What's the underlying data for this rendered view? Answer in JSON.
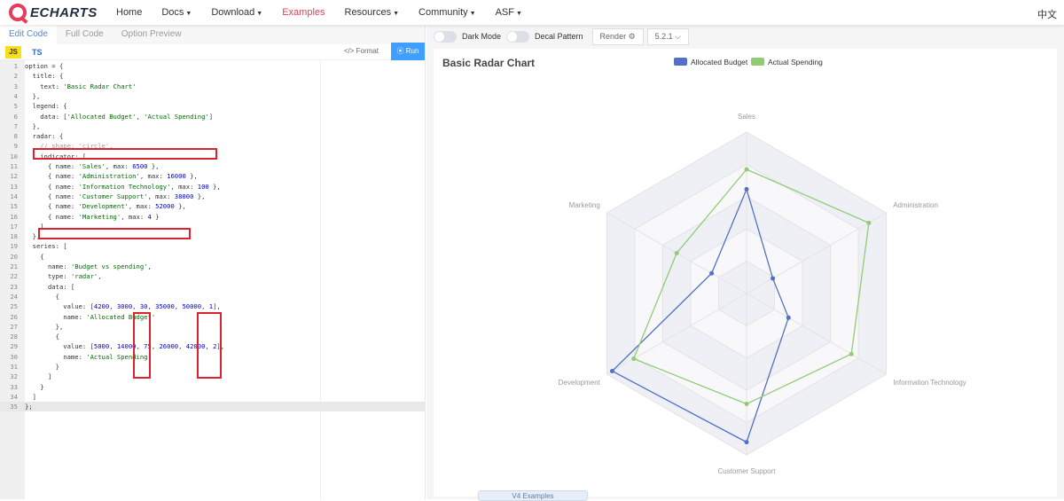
{
  "nav": {
    "logo": "ECHARTS",
    "items": [
      "Home",
      "Docs",
      "Download",
      "Examples",
      "Resources",
      "Community",
      "ASF"
    ],
    "dropdown": [
      false,
      true,
      true,
      false,
      true,
      true,
      true
    ],
    "active": "Examples",
    "lang": "中文"
  },
  "editor": {
    "tabs": [
      "Edit Code",
      "Full Code",
      "Option Preview"
    ],
    "lang_js": "JS",
    "lang_ts": "TS",
    "format": "</> Format",
    "run": "⦿ Run",
    "lines": [
      "option = {",
      "  title: {",
      "    text: 'Basic Radar Chart'",
      "  },",
      "  legend: {",
      "    data: ['Allocated Budget', 'Actual Spending']",
      "  },",
      "  radar: {",
      "    // shape: 'circle',",
      "    indicator: [",
      "      { name: 'Sales', max: 6500 },",
      "      { name: 'Administration', max: 16000 },",
      "      { name: 'Information Technology', max: 100 },",
      "      { name: 'Customer Support', max: 38000 },",
      "      { name: 'Development', max: 52000 },",
      "      { name: 'Marketing', max: 4 }",
      "    ]",
      "  },",
      "  series: [",
      "    {",
      "      name: 'Budget vs spending',",
      "      type: 'radar',",
      "      data: [",
      "        {",
      "          value: [4200, 3000, 30, 35000, 50000, 1],",
      "          name: 'Allocated Budget'",
      "        },",
      "        {",
      "          value: [5000, 14000, 75, 26000, 42000, 2],",
      "          name: 'Actual Spending'",
      "        }",
      "      ]",
      "    }",
      "  ]",
      "};"
    ]
  },
  "toolbar": {
    "dark_mode": "Dark Mode",
    "decal": "Decal Pattern",
    "render": "Render ⚙",
    "version": "5.2.1 ⌵"
  },
  "footer": "V4 Examples",
  "colors": {
    "budget": "#5470c6",
    "spending": "#91cc75"
  },
  "chart_data": {
    "type": "radar",
    "title": "Basic Radar Chart",
    "indicators": [
      {
        "name": "Sales",
        "max": 6500
      },
      {
        "name": "Administration",
        "max": 16000
      },
      {
        "name": "Information Technology",
        "max": 100
      },
      {
        "name": "Customer Support",
        "max": 38000
      },
      {
        "name": "Development",
        "max": 52000
      },
      {
        "name": "Marketing",
        "max": 4
      }
    ],
    "series": [
      {
        "name": "Allocated Budget",
        "values": [
          4200,
          3000,
          30,
          35000,
          50000,
          1
        ]
      },
      {
        "name": "Actual Spending",
        "values": [
          5000,
          14000,
          75,
          26000,
          42000,
          2
        ]
      }
    ],
    "legend_position": "top-center"
  }
}
